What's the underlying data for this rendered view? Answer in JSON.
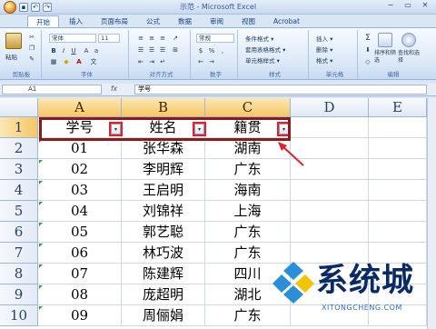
{
  "window": {
    "title": "示范 - Microsoft Excel",
    "controls": [
      "−",
      "▭",
      "✕"
    ]
  },
  "ribbon_tabs": [
    "开始",
    "插入",
    "页面布局",
    "公式",
    "数据",
    "审阅",
    "视图",
    "Acrobat"
  ],
  "ribbon": {
    "paste_label": "粘贴",
    "clipboard_label": "剪贴板",
    "font_name": "宋体",
    "font_size": "11",
    "font_label": "字体",
    "alignment_label": "对齐方式",
    "number_format": "常规",
    "number_label": "数字",
    "styles": [
      "条件格式 ▾",
      "套用表格格式 ▾",
      "单元格样式 ▾"
    ],
    "styles_label": "样式",
    "cells": [
      "插入 ▾",
      "删除 ▾",
      "格式 ▾"
    ],
    "cells_label": "单元格",
    "editing": [
      "排序和筛选",
      "查找和选择"
    ],
    "editing_label": "编辑"
  },
  "formula_bar": {
    "name_box": "A1",
    "fx": "fx",
    "value": "学号"
  },
  "columns": [
    "A",
    "B",
    "C",
    "D",
    "E"
  ],
  "rows": [
    "1",
    "2",
    "3",
    "4",
    "5",
    "6",
    "7",
    "8",
    "9",
    "10"
  ],
  "header_row": [
    "学号",
    "姓名",
    "籍贯"
  ],
  "table": [
    [
      "01",
      "张华森",
      "湖南"
    ],
    [
      "02",
      "李明辉",
      "广东"
    ],
    [
      "03",
      "王启明",
      "海南"
    ],
    [
      "04",
      "刘锦祥",
      "上海"
    ],
    [
      "05",
      "郭艺聪",
      "广东"
    ],
    [
      "06",
      "林巧波",
      "广东"
    ],
    [
      "07",
      "陈建辉",
      "四川"
    ],
    [
      "08",
      "庞超明",
      "湖北"
    ],
    [
      "09",
      "周俪娟",
      "广东"
    ]
  ],
  "watermark": {
    "text": "系统城",
    "sub": "XITONGCHENG.COM"
  },
  "colors": {
    "highlight_red": "#e0202a",
    "header_border": "#8b1a1a",
    "selected_header": "#f6c764"
  }
}
